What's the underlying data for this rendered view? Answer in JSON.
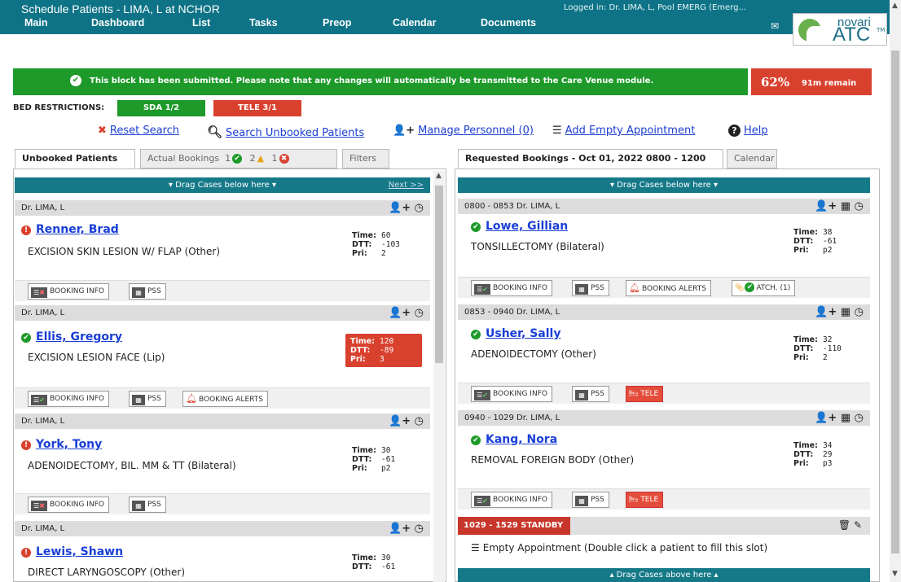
{
  "app": {
    "title": "Schedule Patients - LIMA, L at NCHOR",
    "logged_in": "Logged in: Dr. LIMA, L, Pool EMERG (Emerg...",
    "logo_top": "novari",
    "logo_bottom": "ATC",
    "logo_tm": "TM"
  },
  "nav": [
    "Main",
    "Dashboard",
    "List",
    "Tasks",
    "Preop",
    "Calendar",
    "Documents"
  ],
  "banner": {
    "message": "This block has been submitted. Please note that any changes will automatically be transmitted to the Care Venue module.",
    "percent": "62%",
    "remain": "91m remain"
  },
  "bed_restrictions": {
    "label": "BED RESTRICTIONS:",
    "badges": [
      {
        "text": "SDA 1/2",
        "color": "#1d9a29"
      },
      {
        "text": "TELE 3/1",
        "color": "#d9412f"
      }
    ]
  },
  "toolbar": {
    "reset": "Reset Search",
    "search": "Search Unbooked Patients",
    "manage": "Manage Personnel (0)",
    "add": "Add Empty Appointment",
    "help": "Help"
  },
  "left_tabs": {
    "unbooked": "Unbooked Patients",
    "actual": "Actual Bookings",
    "ok_count": "1",
    "warn_count": "2",
    "err_count": "1",
    "filters": "Filters"
  },
  "right_tabs": {
    "requested": "Requested Bookings - Oct 01, 2022  0800 - 1200",
    "calendar": "Calendar"
  },
  "drag_below": "▾ Drag Cases below here ▾",
  "drag_above": "▴ Drag Cases above here ▴",
  "next": "Next >>",
  "labels": {
    "time": "Time:",
    "dtt": "DTT:",
    "pri": "Pri:"
  },
  "buttons": {
    "booking_info": "BOOKING INFO",
    "pss": "PSS",
    "booking_alerts": "BOOKING ALERTS",
    "tele": "TELE",
    "attach": "ATCH. (1)"
  },
  "unbooked": [
    {
      "header": "Dr. LIMA, L",
      "name": "Renner, Brad",
      "status": "error",
      "procedure": "EXCISION SKIN LESION W/ FLAP (Other)",
      "time": "60",
      "dtt": "-103",
      "pri": "2"
    },
    {
      "header": "Dr. LIMA, L",
      "name": "Ellis, Gregory",
      "status": "ok",
      "procedure": "EXCISION LESION FACE (Lip)",
      "time": "120",
      "dtt": "-89",
      "pri": "3"
    },
    {
      "header": "Dr. LIMA, L",
      "name": "York, Tony",
      "status": "error",
      "procedure": "ADENOIDECTOMY, BIL. MM & TT (Bilateral)",
      "time": "30",
      "dtt": "-61",
      "pri": "p2"
    },
    {
      "header": "Dr. LIMA, L",
      "name": "Lewis, Shawn",
      "status": "error",
      "procedure": "DIRECT LARYNGOSCOPY (Other)",
      "time": "30",
      "dtt": "-61"
    }
  ],
  "requested": [
    {
      "header": "0800 - 0853 Dr. LIMA, L",
      "name": "Lowe, Gillian",
      "procedure": "TONSILLECTOMY (Bilateral)",
      "time": "38",
      "dtt": "-61",
      "pri": "p2"
    },
    {
      "header": "0853 - 0940 Dr. LIMA, L",
      "name": "Usher, Sally",
      "procedure": "ADENOIDECTOMY (Other)",
      "time": "32",
      "dtt": "-110",
      "pri": "2"
    },
    {
      "header": "0940 - 1029 Dr. LIMA, L",
      "name": "Kang, Nora",
      "procedure": "REMOVAL FOREIGN BODY (Other)",
      "time": "34",
      "dtt": "29",
      "pri": "p3"
    }
  ],
  "standby": {
    "label": "1029 - 1529   STANDBY",
    "text": "Empty Appointment (Double click a patient to fill this slot)"
  }
}
